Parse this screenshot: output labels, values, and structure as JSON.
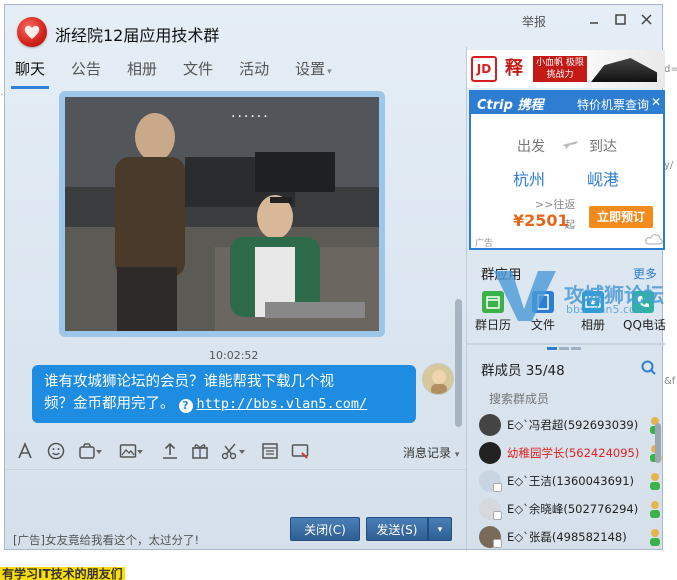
{
  "window": {
    "title": "浙经院12届应用技术群",
    "report_label": "举报"
  },
  "tabs": [
    {
      "label": "聊天",
      "active": true
    },
    {
      "label": "公告"
    },
    {
      "label": "相册"
    },
    {
      "label": "文件"
    },
    {
      "label": "活动"
    },
    {
      "label": "设置"
    }
  ],
  "chat": {
    "image_more": "......",
    "timestamp": "10:02:52",
    "message_line1": "谁有攻城狮论坛的会员？谁能帮我下载几个视",
    "message_line2_prefix": "频？金币都用完了。",
    "message_link": "http://bbs.vlan5.com/"
  },
  "toolbar": {
    "message_history": "消息记录"
  },
  "input": {
    "ad_text": "[广告]女友竟给我看这个，太过分了!",
    "close_button": "关闭(C)",
    "send_button": "发送(S)"
  },
  "ads": {
    "banner_text": "释",
    "banner_sub": "小血帆 极限挑战力",
    "banner_tag": "JD",
    "ctrip_logo": "Ctrip 携程",
    "ctrip_right": "特价机票查询",
    "from_label": "出发",
    "to_label": "到达",
    "from_city": "杭州",
    "to_city": "岘港",
    "return_label": ">>往返",
    "price": "¥2501",
    "price_suffix": "起",
    "book_button": "立即预订",
    "ad_tag": "广告"
  },
  "group_apps": {
    "title": "群应用",
    "more": "更多",
    "items": [
      {
        "label": "群日历",
        "icon": "calendar-icon",
        "color": "#3bb14a"
      },
      {
        "label": "文件",
        "icon": "file-icon",
        "color": "#2d7dd2"
      },
      {
        "label": "相册",
        "icon": "album-icon",
        "color": "#2d9cd2"
      },
      {
        "label": "QQ电话",
        "icon": "phone-icon",
        "color": "#2db3a0"
      }
    ]
  },
  "members": {
    "title": "群成员 35/48",
    "search_placeholder": "搜索群成员",
    "list": [
      {
        "name": "E◇`冯君超(592693039)",
        "color": "#222222"
      },
      {
        "name": "幼稚园学长(562424095)",
        "color": "#e02020"
      },
      {
        "name": "E◇`王洁(1360043691)",
        "color": "#222222"
      },
      {
        "name": "E◇`余晓峰(502776294)",
        "color": "#222222"
      },
      {
        "name": "E◇`张磊(498582148)",
        "color": "#222222"
      }
    ]
  },
  "watermark": {
    "title": "攻城狮论坛",
    "url": "bbs.vlan5.com"
  },
  "background_page": {
    "bottom_text": "有学习IT技术的朋友们"
  },
  "colors": {
    "accent": "#2d7dd2",
    "bubble": "#1e8ce0",
    "send_button": "#2e5f95",
    "owner_name": "#e02020"
  }
}
